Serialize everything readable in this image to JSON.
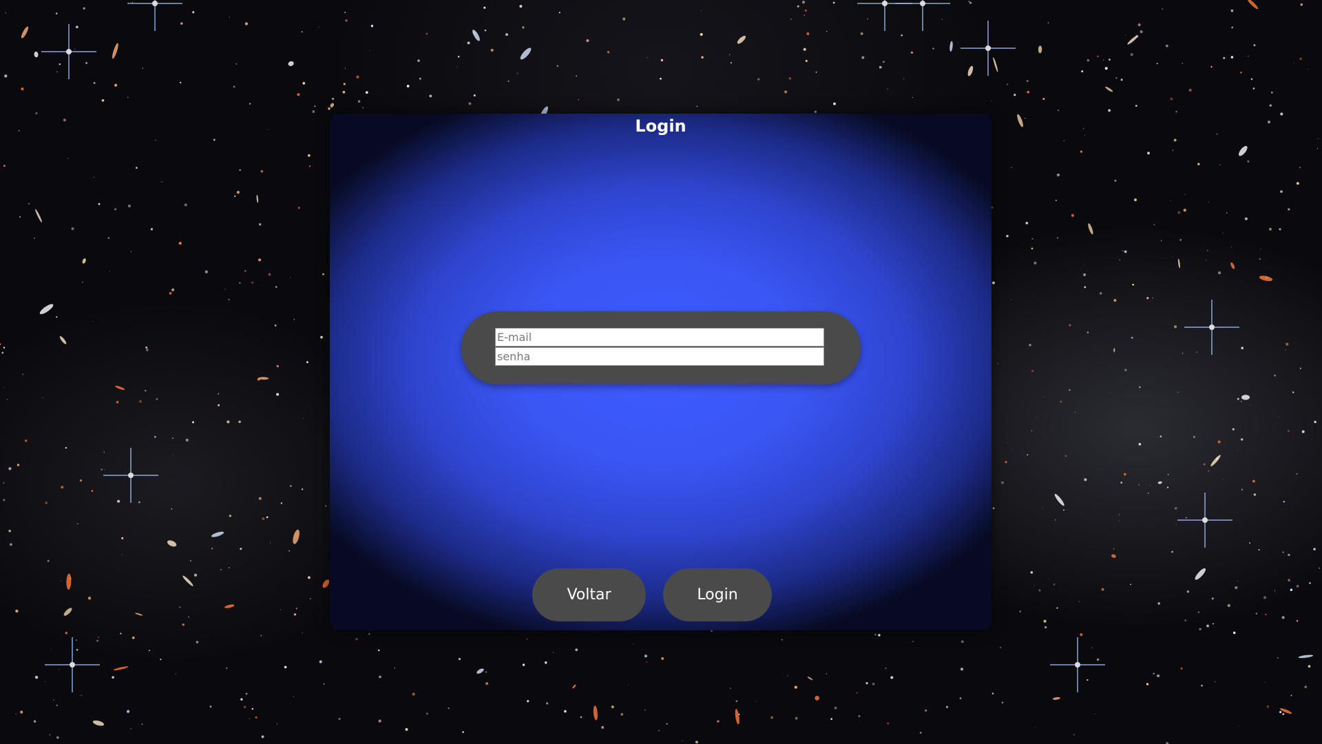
{
  "page": {
    "title": "Login"
  },
  "form": {
    "email_placeholder": "E-mail",
    "password_placeholder": "senha"
  },
  "buttons": {
    "back_label": "Voltar",
    "login_label": "Login"
  },
  "colors": {
    "panel_center": "#3d5bff",
    "panel_edge": "#070a22",
    "pill_background": "#4a4a4a",
    "text": "#ffffff"
  }
}
